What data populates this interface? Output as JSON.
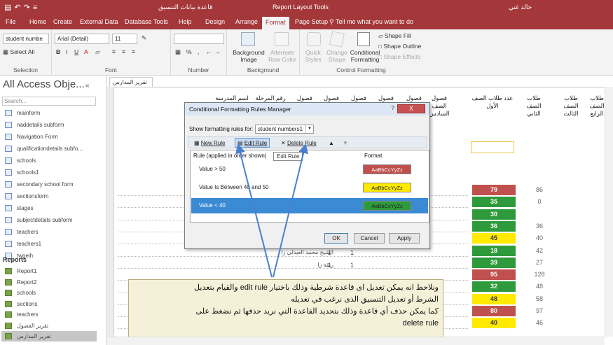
{
  "window": {
    "left_title": "قاعدة بيانات التنسيق",
    "center_title": "Report Layout Tools",
    "user": "خالد غني"
  },
  "tabs": [
    "File",
    "Home",
    "Create",
    "External Data",
    "Database Tools",
    "Help",
    "Design",
    "Arrange",
    "Format",
    "Page Setup"
  ],
  "tell_me": "Tell me what you want to do",
  "ribbon": {
    "selection": {
      "combo": "student numbe",
      "select_all": "Select All",
      "label": "Selection"
    },
    "font": {
      "family": "Arial (Detail)",
      "size": "11",
      "label": "Font"
    },
    "number": {
      "label": "Number",
      "percent": "%"
    },
    "background": {
      "bg_image": "Background Image",
      "alt_row": "Alternate Row Color",
      "label": "Background"
    },
    "control_formatting": {
      "quick_styles": "Quick Styles",
      "change_shape": "Change Shape",
      "conditional": "Conditional Formatting",
      "shape_fill": "Shape Fill",
      "shape_outline": "Shape Outline",
      "shape_effects": "Shape Effects",
      "label": "Control Formatting"
    }
  },
  "nav": {
    "title": "All Access Obje...",
    "search": "Search...",
    "items": [
      "mainform",
      "naddetails subform",
      "Navigation Form",
      "qualificationdetails subfo...",
      "schools",
      "schools1",
      "secondary school form",
      "sectionsform",
      "stages",
      "subjectdetails subform",
      "teachers",
      "teachers1",
      "twgeih"
    ],
    "reports_label": "Reports",
    "reports": [
      "Report1",
      "Report2",
      "schools",
      "sections",
      "teachers",
      "تقرير الفصول",
      "تقرير المدارس"
    ]
  },
  "doc_tab": "تقرير المدارس",
  "headers": {
    "school": "اسم المدرسة",
    "stage": "رقم المرحلة",
    "classes": "فصول",
    "classes6": "فصول الصف السادس",
    "students1": "عدد طلاب الصف الأول",
    "students2": "طلاب الصف الثاني",
    "students3": "طلاب الصف الثالث",
    "students4": "طلاب الصف الرابع"
  },
  "bg_rows": [
    {
      "name": "الشيخ محمد العبدلي زا",
      "a": "1",
      "b": "1"
    },
    {
      "name": "ربقة زا",
      "a": "1",
      "b": "1"
    }
  ],
  "column1": [
    {
      "v": "79",
      "c": "red",
      "v2": "86"
    },
    {
      "v": "35",
      "c": "green",
      "v2": "0"
    },
    {
      "v": "30",
      "c": "green",
      "v2": ""
    },
    {
      "v": "36",
      "c": "green",
      "v2": "36"
    },
    {
      "v": "45",
      "c": "yellow",
      "v2": "40"
    },
    {
      "v": "18",
      "c": "green",
      "v2": "42"
    },
    {
      "v": "39",
      "c": "green",
      "v2": "27"
    },
    {
      "v": "95",
      "c": "red",
      "v2": "128"
    },
    {
      "v": "32",
      "c": "green",
      "v2": "48"
    },
    {
      "v": "48",
      "c": "yellow",
      "v2": "58"
    },
    {
      "v": "80",
      "c": "red",
      "v2": "97"
    },
    {
      "v": "40",
      "c": "yellow",
      "v2": "46"
    }
  ],
  "dialog": {
    "title": "Conditional Formatting Rules Manager",
    "help": "?",
    "close": "X",
    "show_label": "Show formatting rules for:",
    "show_value": "student numbers1",
    "new_rule": "New Rule",
    "edit_rule": "Edit Rule",
    "delete_rule": "Delete Rule",
    "tooltip": "Edit Rule",
    "col_rule": "Rule (applied in order shown)",
    "col_format": "Format",
    "rules": [
      {
        "text": "Value > 50",
        "sample": "AaBbCcYyZz",
        "bg": "#c0504d",
        "fg": "#ffffff"
      },
      {
        "text": "Value Is Between 40 and 50",
        "sample": "AaBbCcYyZz",
        "bg": "#ffea00",
        "fg": "#222222"
      },
      {
        "text": "Value < 40",
        "sample": "AaBbCcYyZz",
        "bg": "#2e9a3b",
        "fg": "#222222"
      }
    ],
    "ok": "OK",
    "cancel": "Cancel",
    "apply": "Apply"
  },
  "note": {
    "line1": "ونلاحظ انه يمكن تعديل اى قاعدة شرطية وذلك باختيار edit rule والقيام بتعديل",
    "line2": "الشرط أو تعديل التنسيق الذى نرغب في تعديله",
    "line3": "كما يمكن حذف أي قاعدة وذلك بتحديد القاعدة التي نريد حذفها ثم نضغط على",
    "line4": "delete rule"
  },
  "colors": {
    "accent": "#a4373a",
    "selected": "#3a8ad4",
    "arrow": "#4a7fd0"
  }
}
